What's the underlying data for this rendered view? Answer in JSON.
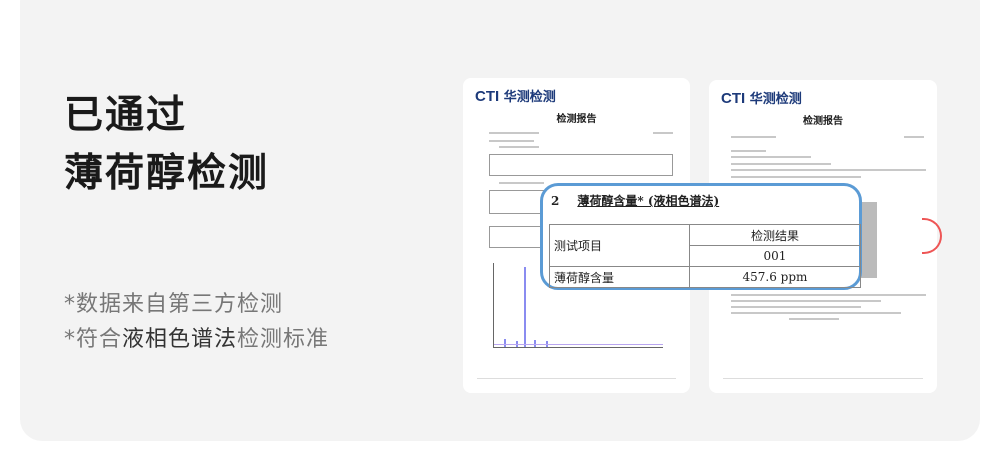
{
  "headline": {
    "line1": "已通过",
    "line2": "薄荷醇检测"
  },
  "bullets": [
    {
      "prefix": "*数据来自第三方检测",
      "highlight": "",
      "suffix": ""
    },
    {
      "prefix": "*符合",
      "highlight": "液相色谱法",
      "suffix": "检测标准"
    }
  ],
  "documents": [
    {
      "logo_mark": "CTI",
      "logo_text": "华测检测",
      "title": "检测报告"
    },
    {
      "logo_mark": "CTI",
      "logo_text": "华测检测",
      "title": "检测报告"
    }
  ],
  "callout": {
    "section_no": "2",
    "section_title": "薄荷醇含量* (液相色谱法)",
    "col_header": "测试项目",
    "result_header": "检测结果",
    "sample_id": "001",
    "row_label": "薄荷醇含量",
    "row_value": "457.6 ppm"
  },
  "colors": {
    "callout_border": "#5b9bd5",
    "logo": "#1d3a7a"
  }
}
